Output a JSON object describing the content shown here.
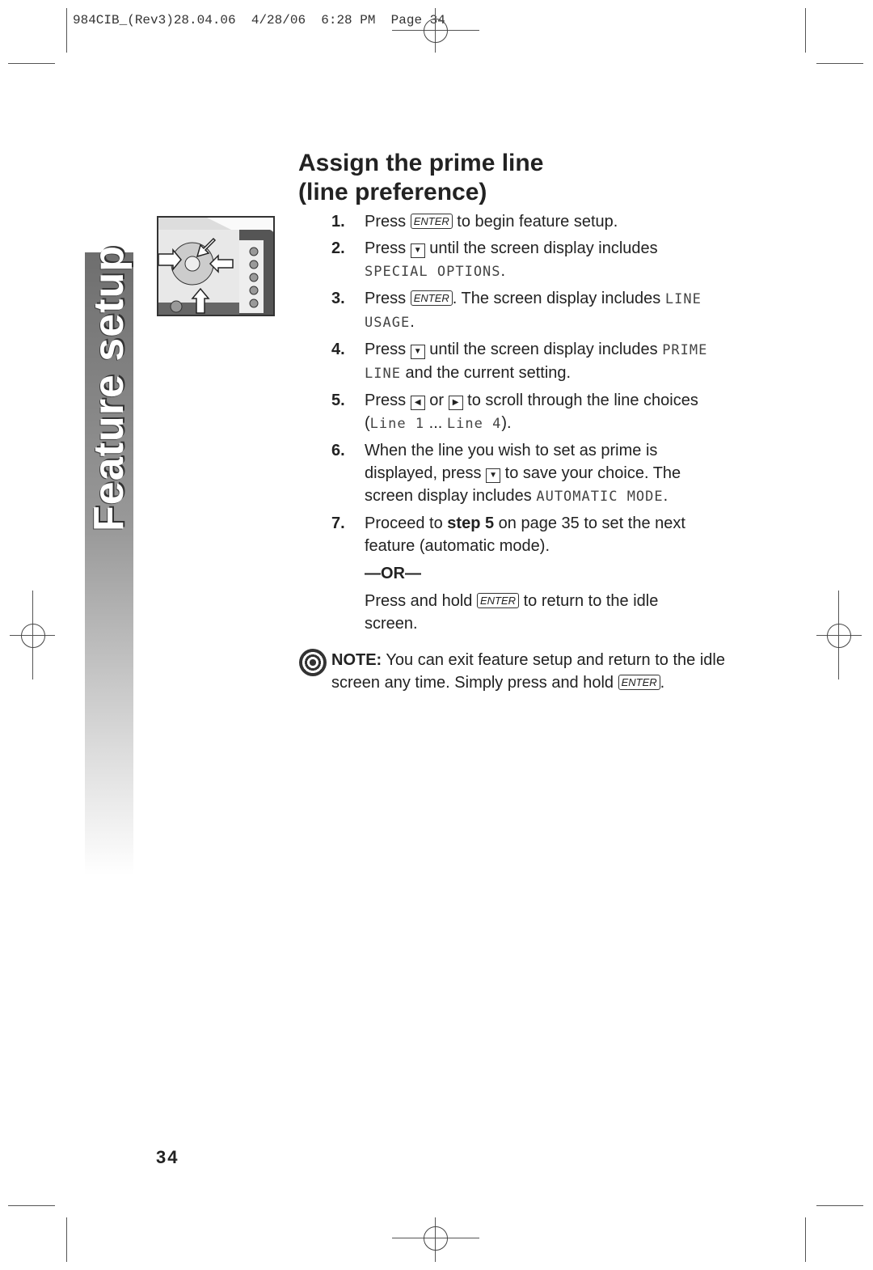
{
  "header": {
    "slug": "984CIB_(Rev3)28.04.06  4/28/06  6:28 PM  Page 34"
  },
  "sidebar": {
    "label": "Feature setup"
  },
  "title": {
    "line1": "Assign the prime line",
    "line2": "(line preference)"
  },
  "steps": [
    {
      "n": "1.",
      "parts": [
        {
          "t": "Press "
        },
        {
          "k": "ENTER"
        },
        {
          "t": " to begin feature setup."
        }
      ]
    },
    {
      "n": "2.",
      "parts": [
        {
          "t": "Press "
        },
        {
          "i": "down"
        },
        {
          "t": " until the screen display includes "
        },
        {
          "m": "SPECIAL OPTIONS"
        },
        {
          "t": "."
        }
      ]
    },
    {
      "n": "3.",
      "parts": [
        {
          "t": "Press "
        },
        {
          "k": "ENTER"
        },
        {
          "t": ". The screen display includes "
        },
        {
          "m": "LINE USAGE"
        },
        {
          "t": "."
        }
      ]
    },
    {
      "n": "4.",
      "parts": [
        {
          "t": "Press "
        },
        {
          "i": "down"
        },
        {
          "t": " until the screen display includes "
        },
        {
          "m": "PRIME LINE"
        },
        {
          "t": " and the current setting."
        }
      ]
    },
    {
      "n": "5.",
      "parts": [
        {
          "t": "Press "
        },
        {
          "i": "left"
        },
        {
          "t": " or "
        },
        {
          "i": "right"
        },
        {
          "t": " to scroll through the line choices ("
        },
        {
          "m": "Line 1"
        },
        {
          "t": " ... "
        },
        {
          "m": "Line 4"
        },
        {
          "t": ")."
        }
      ]
    },
    {
      "n": "6.",
      "parts": [
        {
          "t": "When the line you wish to set as prime is displayed, press "
        },
        {
          "i": "down"
        },
        {
          "t": " to save your choice.  The screen display includes "
        },
        {
          "m": "AUTOMATIC MODE"
        },
        {
          "t": "."
        }
      ]
    },
    {
      "n": "7.",
      "parts": [
        {
          "t": "Proceed to "
        },
        {
          "b": "step 5"
        },
        {
          "t": " on page 35 to set the next feature (automatic mode)."
        }
      ]
    }
  ],
  "or_label": "—OR—",
  "alt_step": [
    {
      "t": "Press and hold "
    },
    {
      "k": "ENTER"
    },
    {
      "t": " to return to the idle screen."
    }
  ],
  "note": {
    "label": "NOTE:",
    "parts": [
      {
        "t": " You can exit feature setup and return to the idle screen any time.  Simply press and hold "
      },
      {
        "k": "ENTER"
      },
      {
        "t": "."
      }
    ]
  },
  "page_number": "34",
  "icons": {
    "down": "▼",
    "left": "◀",
    "right": "▶"
  }
}
